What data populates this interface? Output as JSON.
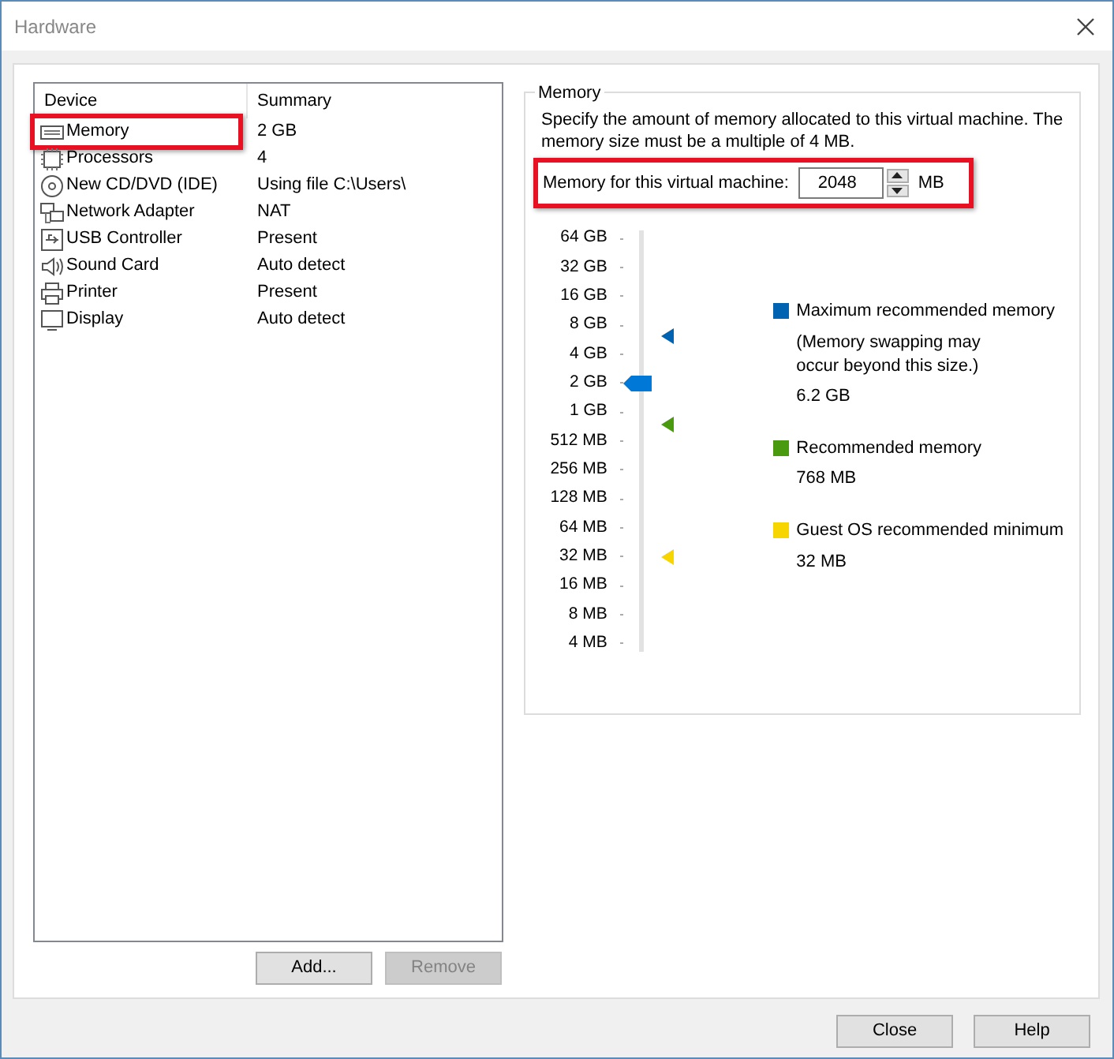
{
  "window": {
    "title": "Hardware"
  },
  "device_table": {
    "columns": [
      "Device",
      "Summary"
    ],
    "rows": [
      {
        "kind": "memory",
        "device": "Memory",
        "summary": "2 GB",
        "highlighted": true
      },
      {
        "kind": "cpu",
        "device": "Processors",
        "summary": "4",
        "highlighted": false
      },
      {
        "kind": "disc",
        "device": "New CD/DVD (IDE)",
        "summary": "Using file C:\\Users\\",
        "highlighted": false
      },
      {
        "kind": "network",
        "device": "Network Adapter",
        "summary": "NAT",
        "highlighted": false
      },
      {
        "kind": "usb",
        "device": "USB Controller",
        "summary": "Present",
        "highlighted": false
      },
      {
        "kind": "sound",
        "device": "Sound Card",
        "summary": "Auto detect",
        "highlighted": false
      },
      {
        "kind": "printer",
        "device": "Printer",
        "summary": "Present",
        "highlighted": false
      },
      {
        "kind": "display",
        "device": "Display",
        "summary": "Auto detect",
        "highlighted": false
      }
    ]
  },
  "device_buttons": [
    {
      "label": "Add...",
      "disabled": false
    },
    {
      "label": "Remove",
      "disabled": true
    }
  ],
  "memory": {
    "title": "Memory",
    "description": "Specify the amount of memory allocated to this virtual machine. The memory size must be a multiple of 4 MB.",
    "field_label": "Memory for this virtual machine:",
    "value": "2048",
    "unit": "MB",
    "highlighted": true,
    "scale": [
      "64 GB",
      "32 GB",
      "16 GB",
      "8 GB",
      "4 GB",
      "2 GB",
      "1 GB",
      "512 MB",
      "256 MB",
      "128 MB",
      "64 MB",
      "32 MB",
      "16 MB",
      "8 MB",
      "4 MB"
    ],
    "level": 0.643,
    "legend": [
      {
        "label": "Maximum recommended memory",
        "note": "(Memory swapping may occur beyond this size.)",
        "value": "6.2 GB",
        "color": "#0063b1",
        "level": 0.759
      },
      {
        "label": "Recommended memory",
        "value": "768 MB",
        "color": "#4a9a0f",
        "level": 0.542
      },
      {
        "label": "Guest OS recommended minimum",
        "value": "32 MB",
        "color": "#f6d500",
        "level": 0.214
      }
    ]
  },
  "footer_buttons": [
    "Close",
    "Help"
  ]
}
